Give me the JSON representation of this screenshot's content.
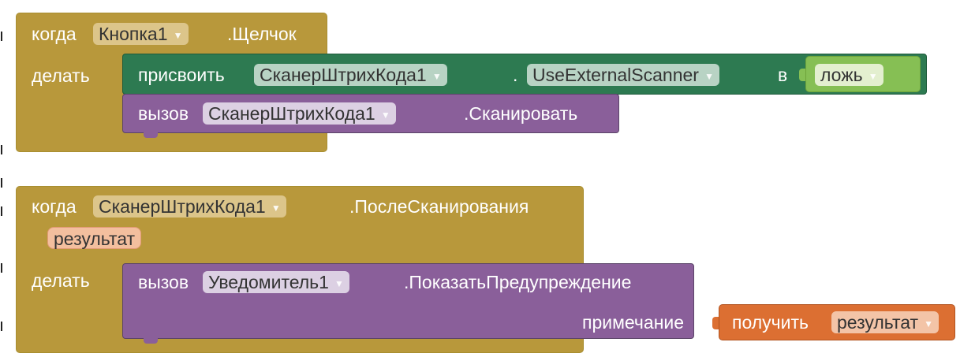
{
  "colors": {
    "event": "#b8983b",
    "setter": "#2d7a51",
    "method": "#8a5f9a",
    "logic": "#86bf54",
    "variable": "#dc6f32",
    "background": "#ffffff"
  },
  "icons": {
    "dropdown": "dropdown-triangle-icon"
  },
  "block1": {
    "when": "когда",
    "component": "Кнопка1",
    "event": ".Щелчок",
    "do": "делать",
    "setter": {
      "label": "присвоить",
      "component": "СканерШтрихКода1",
      "dot": ".",
      "property": "UseExternalScanner",
      "to": "в",
      "value": "ложь"
    },
    "call": {
      "label": "вызов",
      "component": "СканерШтрихКода1",
      "method": ".Сканировать"
    }
  },
  "block2": {
    "when": "когда",
    "component": "СканерШтрихКода1",
    "event": ".ПослеСканирования",
    "param": "результат",
    "do": "делать",
    "call": {
      "label": "вызов",
      "component": "Уведомитель1",
      "method": ".ПоказатьПредупреждение",
      "arg_label": "примечание",
      "arg": {
        "label": "получить",
        "variable": "результат"
      }
    }
  }
}
